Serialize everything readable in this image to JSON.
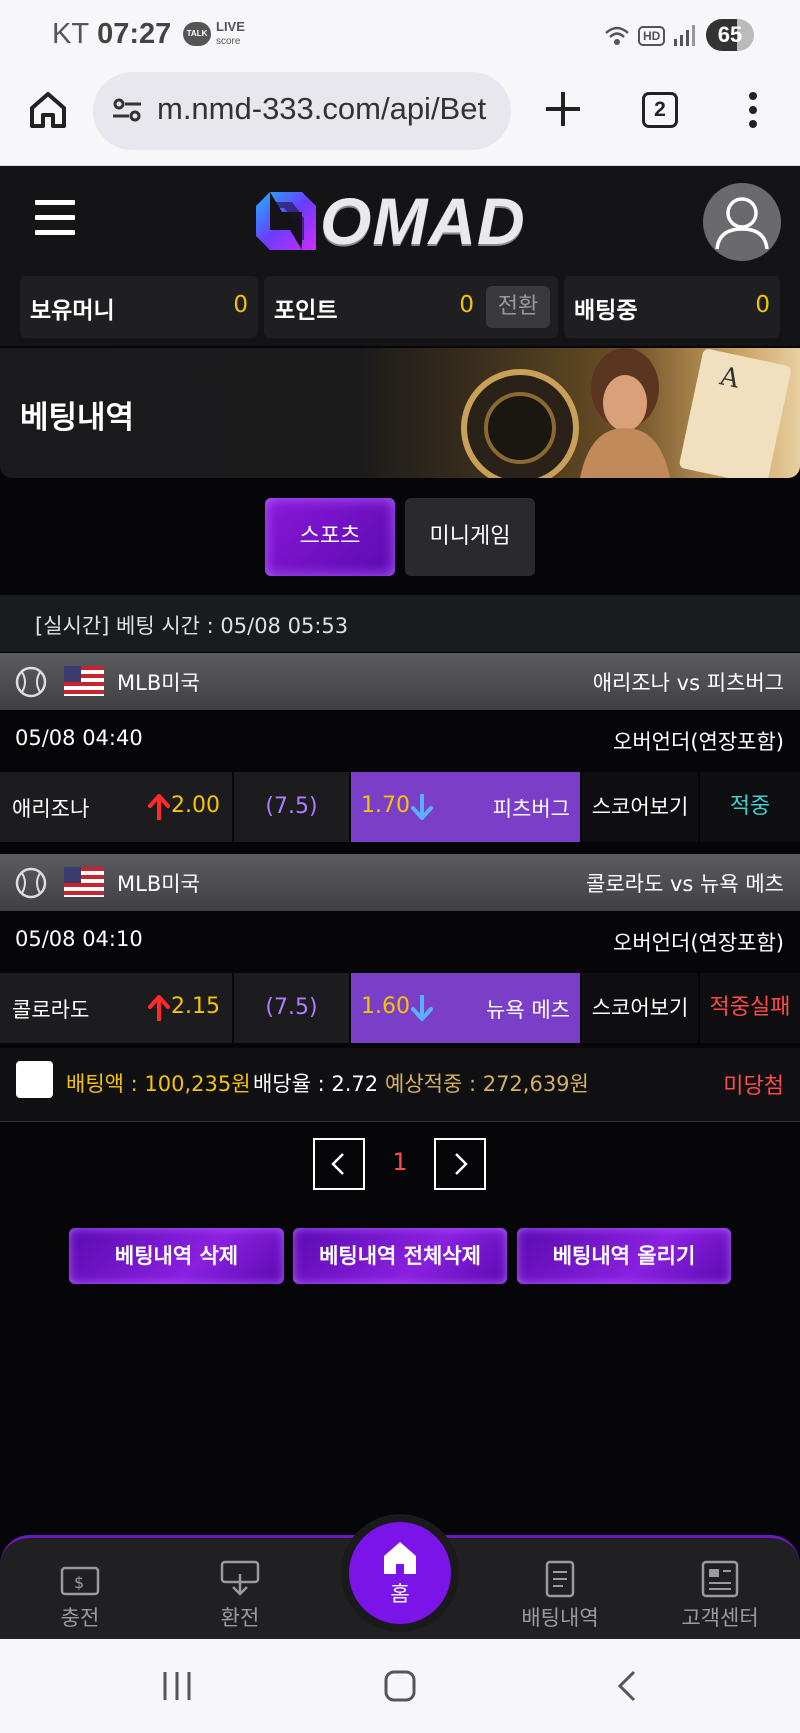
{
  "status_bar": {
    "carrier": "KT",
    "time": "07:27",
    "talk_badge": "TALK",
    "live_line1": "LIVE",
    "live_line2": "score",
    "hd": "HD",
    "battery": "65"
  },
  "browser": {
    "url": "m.nmd-333.com/api/Bet",
    "tab_count": "2"
  },
  "site": {
    "logo_text": "OMAD"
  },
  "wallet": {
    "money_label": "보유머니",
    "money_value": "0",
    "point_label": "포인트",
    "point_value": "0",
    "convert_label": "전환",
    "betting_label": "배팅중",
    "betting_value": "0"
  },
  "page_title": "베팅내역",
  "tabs": {
    "sports": "스포츠",
    "minigame": "미니게임"
  },
  "bet_time": "[실시간] 베팅 시간 : 05/08 05:53",
  "games": [
    {
      "league": "MLB미국",
      "match": "애리조나 vs 피츠버그",
      "datetime": "05/08 04:40",
      "market": "오버언더(연장포함)",
      "home_team": "애리조나",
      "home_odd": "2.00",
      "line": "(7.5)",
      "away_odd": "1.70",
      "away_team": "피츠버그",
      "score_label": "스코어보기",
      "result": "적중",
      "result_color": "#3fd0d0"
    },
    {
      "league": "MLB미국",
      "match": "콜로라도 vs 뉴욕 메츠",
      "datetime": "05/08 04:10",
      "market": "오버언더(연장포함)",
      "home_team": "콜로라도",
      "home_odd": "2.15",
      "line": "(7.5)",
      "away_odd": "1.60",
      "away_team": "뉴욕 메츠",
      "score_label": "스코어보기",
      "result": "적중실패",
      "result_color": "#ff4a4a"
    }
  ],
  "summary": {
    "bet_amount": "배팅액 : 100,235원",
    "dividend": "배당율 : 2.72",
    "expected": "예상적중 : 272,639원",
    "result": "미당첨"
  },
  "pagination": {
    "current": "1"
  },
  "actions": {
    "delete": "베팅내역 삭제",
    "delete_all": "베팅내역 전체삭제",
    "post": "베팅내역 올리기"
  },
  "bottom_nav": {
    "charge": "충전",
    "exchange": "환전",
    "home": "홈",
    "history": "배팅내역",
    "support": "고객센터"
  },
  "colors": {
    "accent": "#7a14e8",
    "highlight": "#7a3ec8",
    "gold": "#f5c400",
    "fail": "#ff4a4a",
    "win": "#3fd0d0"
  }
}
